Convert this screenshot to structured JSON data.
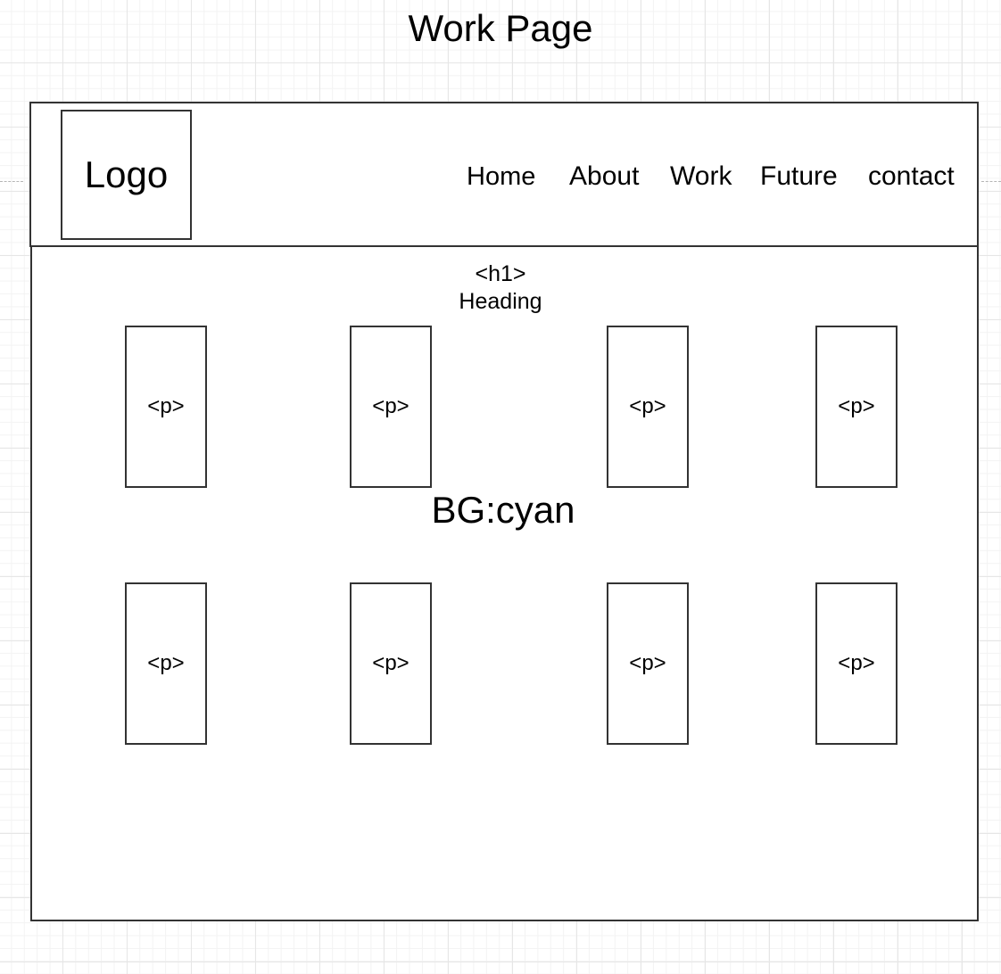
{
  "page_title": "Work Page",
  "header": {
    "logo_label": "Logo",
    "nav": {
      "home": "Home",
      "about": "About",
      "work": "Work",
      "future": "Future",
      "contact": "contact"
    }
  },
  "main": {
    "heading_tag": "<h1>",
    "heading_text": "Heading",
    "background_note": "BG:cyan",
    "paragraph_placeholders": [
      "<p>",
      "<p>",
      "<p>",
      "<p>",
      "<p>",
      "<p>",
      "<p>",
      "<p>"
    ]
  }
}
